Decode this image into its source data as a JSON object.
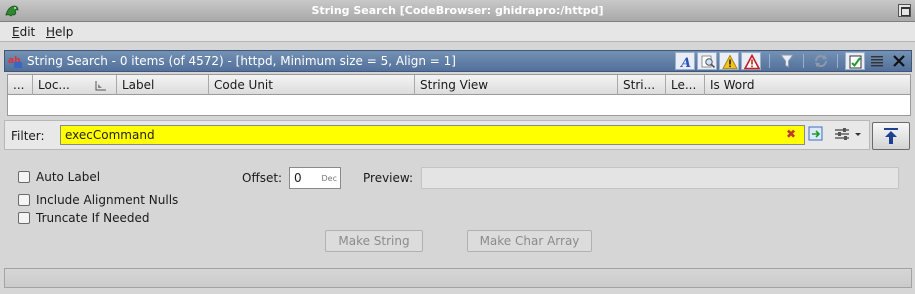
{
  "window": {
    "title": "String Search [CodeBrowser: ghidrapro:/httpd]"
  },
  "menu": {
    "items": [
      "Edit",
      "Help"
    ]
  },
  "panel": {
    "title": "String Search - 0 items (of 4572) - [httpd, Minimum size = 5, Align = 1]",
    "toolbar_icons": [
      "font-icon",
      "magnify-icon",
      "warning-icon",
      "error-icon",
      "funnel-icon",
      "refresh-icon",
      "make-string-icon",
      "list-icon",
      "close-icon"
    ]
  },
  "table": {
    "columns": [
      "...",
      "Loc...",
      "Label",
      "Code Unit",
      "String View",
      "Stri...",
      "Le...",
      "Is Word"
    ],
    "rows": []
  },
  "filter": {
    "label": "Filter:",
    "value": "execCommand"
  },
  "options": {
    "auto_label": "Auto Label",
    "include_alignment_nulls": "Include Alignment Nulls",
    "truncate_if_needed": "Truncate If Needed",
    "offset_label": "Offset:",
    "offset_value": "0",
    "offset_unit": "Dec",
    "preview_label": "Preview:",
    "preview_value": ""
  },
  "buttons": {
    "make_string": "Make String",
    "make_char_array": "Make Char Array"
  },
  "status": {
    "text": ""
  },
  "colors": {
    "filter_bg": "#ffff00",
    "panel_header": "#5a78a3"
  }
}
